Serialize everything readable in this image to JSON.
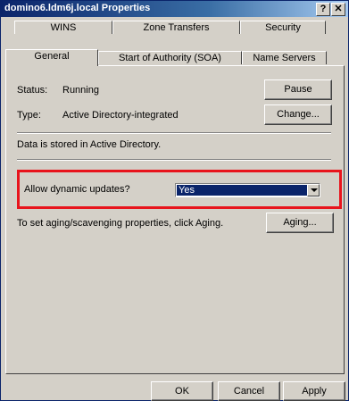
{
  "window": {
    "title": "domino6.ldm6j.local Properties",
    "help_label": "?",
    "close_label": "✕"
  },
  "tabs_back": [
    {
      "label": "WINS"
    },
    {
      "label": "Zone Transfers"
    },
    {
      "label": "Security"
    }
  ],
  "tabs_front": [
    {
      "label": "General",
      "selected": true
    },
    {
      "label": "Start of Authority (SOA)",
      "selected": false
    },
    {
      "label": "Name Servers",
      "selected": false
    }
  ],
  "general": {
    "status_label": "Status:",
    "status_value": "Running",
    "pause_label": "Pause",
    "type_label": "Type:",
    "type_value": "Active Directory-integrated",
    "change_label": "Change...",
    "stored_text": "Data is stored in Active Directory.",
    "dynamic_label": "Allow dynamic updates?",
    "dynamic_value": "Yes",
    "aging_text": "To set aging/scavenging properties, click Aging.",
    "aging_label": "Aging..."
  },
  "footer": {
    "ok_label": "OK",
    "cancel_label": "Cancel",
    "apply_label": "Apply"
  },
  "colors": {
    "titlebar_start": "#0a246a",
    "titlebar_end": "#a6caf0",
    "dialog_bg": "#d4d0c8",
    "highlight_border": "#e8141c",
    "selection_bg": "#0a246a"
  },
  "icons": [
    "chevron-down-icon"
  ]
}
